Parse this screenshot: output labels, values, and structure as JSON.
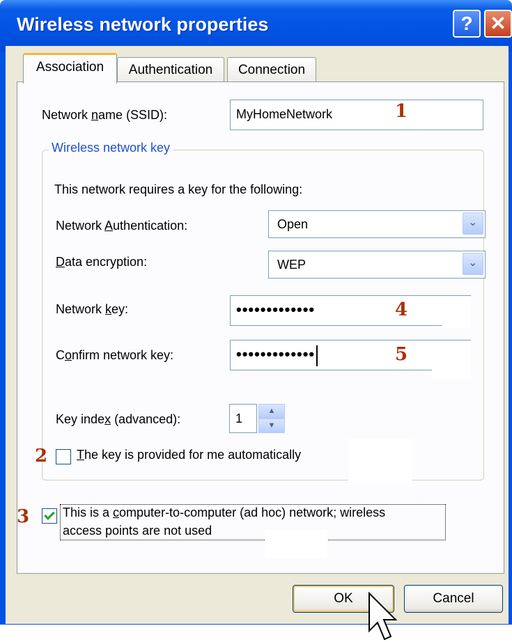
{
  "dialog": {
    "title": "Wireless network properties",
    "help_label": "?",
    "close_label": "✕"
  },
  "tabs": [
    {
      "label": "Association",
      "active": true
    },
    {
      "label": "Authentication",
      "active": false
    },
    {
      "label": "Connection",
      "active": false
    }
  ],
  "ssid": {
    "label_pre": "Network ",
    "label_u": "n",
    "label_post": "ame (SSID):",
    "value": "MyHomeNetwork"
  },
  "group": {
    "legend": "Wireless network key",
    "intro": "This network requires a key for the following:"
  },
  "auth": {
    "label_pre": "Network ",
    "label_u": "A",
    "label_post": "uthentication:",
    "value": "Open"
  },
  "encryption": {
    "label_u": "D",
    "label_post": "ata encryption:",
    "value": "WEP"
  },
  "network_key": {
    "label_pre": "Network ",
    "label_u": "k",
    "label_post": "ey:",
    "value": "•••••••••••••"
  },
  "confirm_key": {
    "label_pre": "C",
    "label_u": "o",
    "label_post": "nfirm network key:",
    "value": "•••••••••••••"
  },
  "key_index": {
    "label_pre": "Key inde",
    "label_u": "x",
    "label_post": " (advanced):",
    "value": "1"
  },
  "auto_key": {
    "label_u": "T",
    "label_post": "he key is provided for me automatically",
    "checked": false
  },
  "adhoc": {
    "line1_pre": "This is a ",
    "line1_u": "c",
    "line1_post": "omputer-to-computer (ad hoc) network; wireless",
    "line2": "access points are not used",
    "checked": true
  },
  "annotations": [
    "1",
    "2",
    "3",
    "4",
    "5"
  ],
  "buttons": {
    "ok": "OK",
    "cancel": "Cancel"
  },
  "colors": {
    "titlebar": "#0055e5",
    "face": "#ece9d8",
    "annotation": "#a8320a",
    "legend": "#1f4fc9"
  }
}
